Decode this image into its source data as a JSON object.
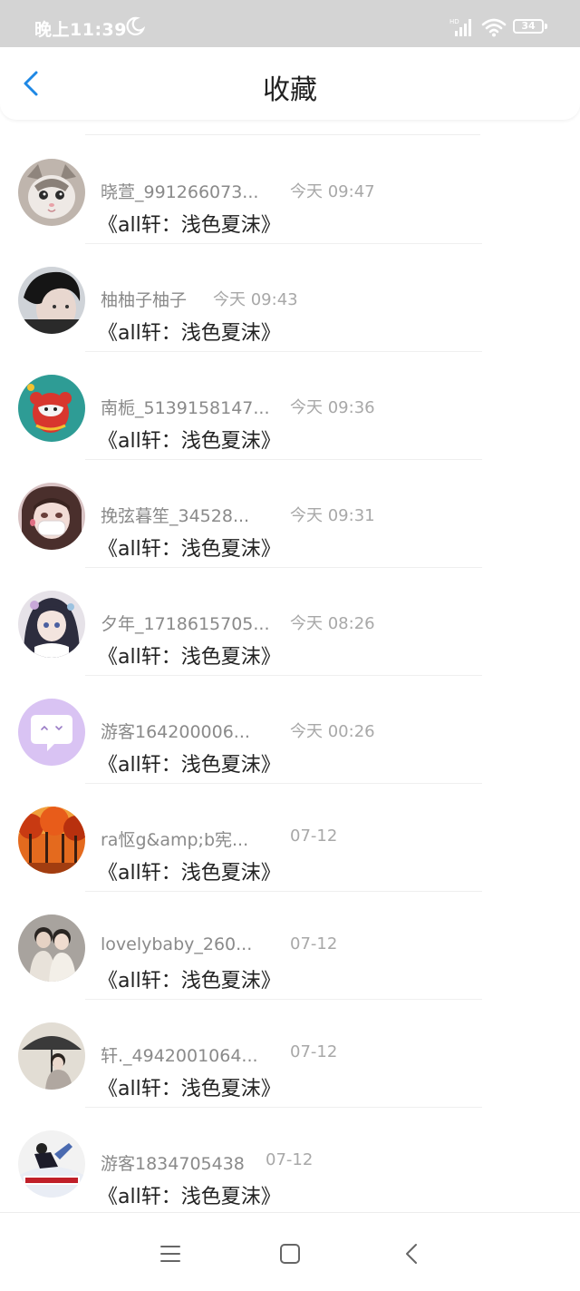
{
  "status_bar": {
    "time": "晚上11:39",
    "battery": "34"
  },
  "header": {
    "title": "收藏"
  },
  "items": [
    {
      "name": "晓萱_991266073...",
      "time": "今天 09:47",
      "title": "《all轩：浅色夏沫》",
      "avatar": "cat-avatar"
    },
    {
      "name": "柚柚子柚子",
      "time": "今天 09:43",
      "title": "《all轩：浅色夏沫》",
      "avatar": "boy-avatar"
    },
    {
      "name": "南栀_5139158147...",
      "time": "今天 09:36",
      "title": "《all轩：浅色夏沫》",
      "avatar": "cartoon-avatar"
    },
    {
      "name": "挽弦暮笙_34528...",
      "time": "今天 09:31",
      "title": "《all轩：浅色夏沫》",
      "avatar": "girl-mask-avatar"
    },
    {
      "name": "夕年_1718615705...",
      "time": "今天 08:26",
      "title": "《all轩：浅色夏沫》",
      "avatar": "anime-girl-avatar"
    },
    {
      "name": "游客164200006...",
      "time": "今天 00:26",
      "title": "《all轩：浅色夏沫》",
      "avatar": "default-chat-avatar"
    },
    {
      "name": "ra怄g&amp;b宪...",
      "time": "07-12",
      "title": "《all轩：浅色夏沫》",
      "avatar": "autumn-trees-avatar"
    },
    {
      "name": "lovelybaby_260...",
      "time": "07-12",
      "title": "《all轩：浅色夏沫》",
      "avatar": "couple-avatar"
    },
    {
      "name": "轩._4942001064...",
      "time": "07-12",
      "title": "《all轩：浅色夏沫》",
      "avatar": "umbrella-avatar"
    },
    {
      "name": "游客1834705438",
      "time": "07-12",
      "title": "《all轩：浅色夏沫》",
      "avatar": "poster-avatar"
    }
  ],
  "colors": {
    "accent": "#1e88e5",
    "status_bar_bg": "#d4d4d4"
  },
  "nav": {
    "icons": [
      "menu-icon",
      "home-square-icon",
      "back-triangle-icon"
    ]
  }
}
